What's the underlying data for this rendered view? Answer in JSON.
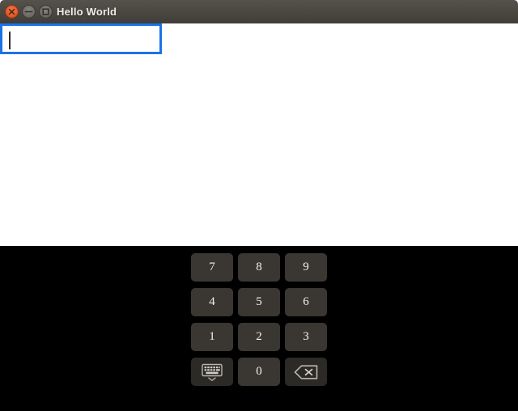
{
  "window": {
    "title": "Hello World",
    "controls": [
      {
        "name": "close",
        "label": "Close",
        "icon": "close-icon",
        "color": "#df5c2c"
      },
      {
        "name": "minimize",
        "label": "Minimize",
        "icon": "minimize-icon",
        "color": "#6f6b65"
      },
      {
        "name": "maximize",
        "label": "Maximize",
        "icon": "maximize-icon",
        "color": "#6f6b65"
      }
    ],
    "titlebar_color": "#4a4640",
    "client_background": "#ffffff"
  },
  "text_entry": {
    "value": "",
    "placeholder": "",
    "focused": true,
    "border_color": "#1a73e8",
    "caret_visible": true
  },
  "keypad": {
    "background": "#000000",
    "key_color": "#3a3733",
    "key_text_color": "#f4f2ef",
    "rows": [
      [
        {
          "label": "7",
          "name": "key-7",
          "type": "digit"
        },
        {
          "label": "8",
          "name": "key-8",
          "type": "digit"
        },
        {
          "label": "9",
          "name": "key-9",
          "type": "digit"
        }
      ],
      [
        {
          "label": "4",
          "name": "key-4",
          "type": "digit"
        },
        {
          "label": "5",
          "name": "key-5",
          "type": "digit"
        },
        {
          "label": "6",
          "name": "key-6",
          "type": "digit"
        }
      ],
      [
        {
          "label": "1",
          "name": "key-1",
          "type": "digit"
        },
        {
          "label": "2",
          "name": "key-2",
          "type": "digit"
        },
        {
          "label": "3",
          "name": "key-3",
          "type": "digit"
        }
      ],
      [
        {
          "label": "",
          "name": "key-hide-keyboard",
          "type": "icon",
          "icon": "keyboard-hide-icon"
        },
        {
          "label": "0",
          "name": "key-0",
          "type": "digit"
        },
        {
          "label": "",
          "name": "key-backspace",
          "type": "icon",
          "icon": "backspace-icon"
        }
      ]
    ]
  }
}
